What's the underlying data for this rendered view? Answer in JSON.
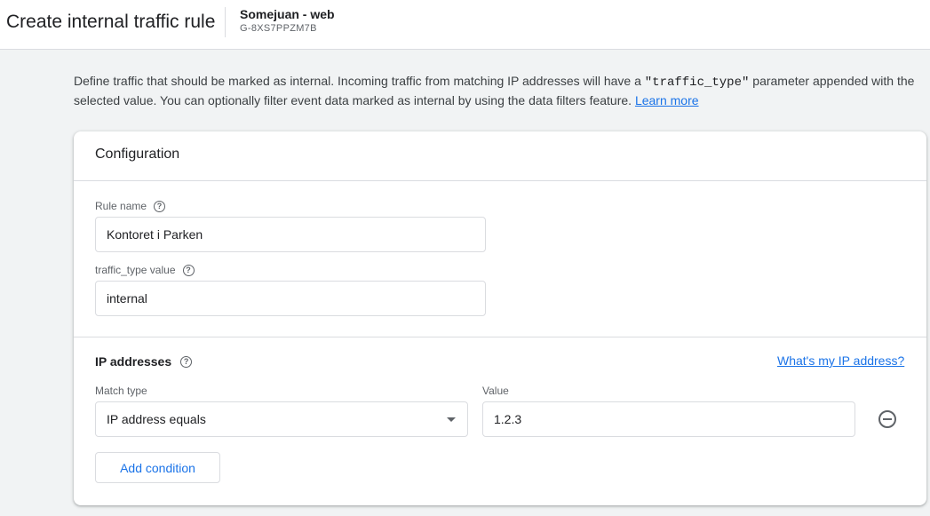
{
  "header": {
    "title": "Create internal traffic rule",
    "property_name": "Somejuan - web",
    "property_id": "G-8XS7PPZM7B"
  },
  "intro": {
    "text_before": "Define traffic that should be marked as internal. Incoming traffic from matching IP addresses will have a ",
    "code": "\"traffic_type\"",
    "text_after": " parameter appended with the selected value. You can optionally filter event data marked as internal by using the data filters feature. ",
    "learn_more": "Learn more"
  },
  "card": {
    "title": "Configuration",
    "rule_name": {
      "label": "Rule name",
      "value": "Kontoret i Parken"
    },
    "traffic_type": {
      "label": "traffic_type value",
      "value": "internal"
    },
    "ip_section": {
      "title": "IP addresses",
      "whats_my_ip": "What's my IP address?",
      "match_type_label": "Match type",
      "match_type_value": "IP address equals",
      "value_label": "Value",
      "value": "1.2.3",
      "add_condition": "Add condition"
    }
  },
  "icons": {
    "help": "help-circle-icon",
    "remove": "remove-circle-icon",
    "dropdown": "dropdown-arrow-icon"
  },
  "colors": {
    "accent": "#1a73e8",
    "background": "#f1f3f4",
    "border": "#dadce0"
  }
}
